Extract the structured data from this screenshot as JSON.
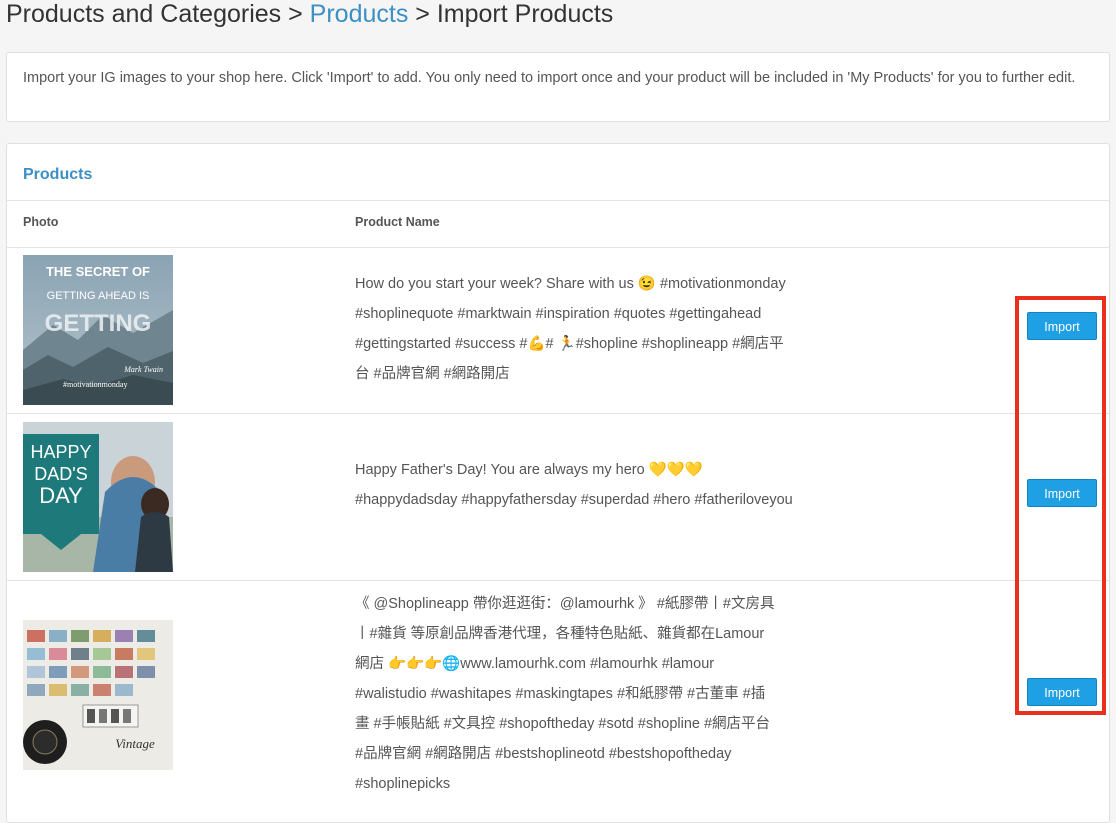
{
  "breadcrumb": {
    "part1": "Products and Categories",
    "sep1": " > ",
    "link": "Products",
    "sep2": " > ",
    "current": "Import Products"
  },
  "info": {
    "text": "Import your IG images to your shop here. Click 'Import' to add. You only need to import once and your product will be included in 'My Products' for you to further edit."
  },
  "panel": {
    "title": "Products",
    "columns": {
      "photo": "Photo",
      "name": "Product Name"
    }
  },
  "products": [
    {
      "name": "How do you start your week? Share with us 😉 #motivationmonday #shoplinequote #marktwain #inspiration #quotes #gettingahead #gettingstarted #success #💪# 🏃#shopline #shoplineapp #網店平台 #品牌官網 #網路開店",
      "import_label": "Import",
      "image_text": {
        "line1": "THE SECRET OF",
        "line2": "GETTING AHEAD IS",
        "line3": "GETTING",
        "signature": "Mark Twain",
        "tag": "#motivationmonday"
      }
    },
    {
      "name": "Happy Father's Day! You are always my hero 💛💛💛 #happydadsday #happyfathersday #superdad #hero #fatheriloveyou",
      "import_label": "Import",
      "image_text": {
        "line1": "HAPPY",
        "line2": "DAD'S",
        "line3": "DAY"
      }
    },
    {
      "name": "《 @Shoplineapp 帶你逛逛街：@lamourhk 》 #紙膠帶丨#文房具丨#雜貨 等原創品牌香港代理，各種特色貼紙、雜貨都在Lamour 網店 👉👉👉🌐www.lamourhk.com #lamourhk #lamour #walistudio #washitapes #maskingtapes #和紙膠帶 #古董車 #插畫 #手帳貼紙 #文具控 #shopoftheday #sotd #shopline #網店平台 #品牌官網 #網路開店 #bestshoplineotd #bestshopoftheday #shoplinepicks",
      "import_label": "Import",
      "image_text": {
        "script": "Vintage"
      }
    }
  ],
  "colors": {
    "accent": "#3d8fc4",
    "button": "#1fa0e5",
    "highlight": "#e8301c"
  }
}
